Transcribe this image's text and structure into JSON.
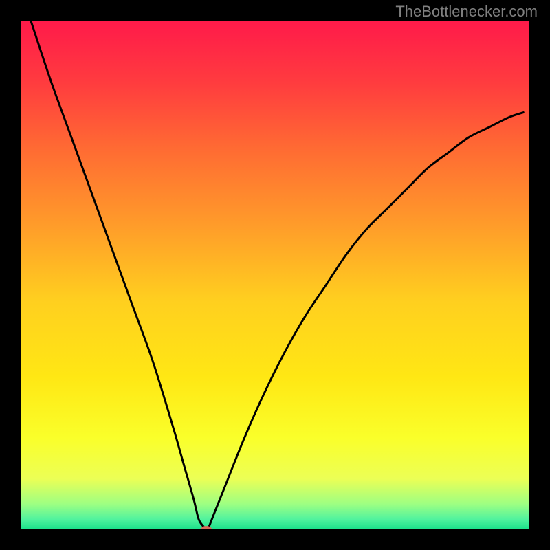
{
  "watermark": "TheBottlenecker.com",
  "chart_data": {
    "type": "line",
    "title": "",
    "xlabel": "",
    "ylabel": "",
    "xlim": [
      0,
      100
    ],
    "ylim": [
      0,
      100
    ],
    "background_gradient": {
      "type": "vertical",
      "stops": [
        {
          "offset": 0.0,
          "color": "#ff1a4a"
        },
        {
          "offset": 0.12,
          "color": "#ff3b3f"
        },
        {
          "offset": 0.25,
          "color": "#ff6a33"
        },
        {
          "offset": 0.4,
          "color": "#ff9b2a"
        },
        {
          "offset": 0.55,
          "color": "#ffcf1f"
        },
        {
          "offset": 0.7,
          "color": "#ffe714"
        },
        {
          "offset": 0.82,
          "color": "#faff2a"
        },
        {
          "offset": 0.9,
          "color": "#ecff55"
        },
        {
          "offset": 0.95,
          "color": "#9eff82"
        },
        {
          "offset": 0.98,
          "color": "#51f39e"
        },
        {
          "offset": 1.0,
          "color": "#19e08a"
        }
      ]
    },
    "series": [
      {
        "name": "bottleneck-curve",
        "color": "#000000",
        "x": [
          2,
          6,
          10,
          14,
          18,
          22,
          26,
          30,
          32,
          34,
          35,
          36,
          36.5,
          37,
          38,
          40,
          44,
          48,
          52,
          56,
          60,
          64,
          68,
          72,
          76,
          80,
          84,
          88,
          92,
          96,
          99
        ],
        "y": [
          100,
          88,
          77,
          66,
          55,
          44,
          33,
          20,
          13,
          6,
          2,
          0.5,
          0,
          0.5,
          3,
          8,
          18,
          27,
          35,
          42,
          48,
          54,
          59,
          63,
          67,
          71,
          74,
          77,
          79,
          81,
          82
        ]
      }
    ],
    "marker": {
      "name": "optimal-point",
      "x": 36.5,
      "y": 0,
      "color": "#d46a5a",
      "rx": 8,
      "ry": 5
    }
  }
}
